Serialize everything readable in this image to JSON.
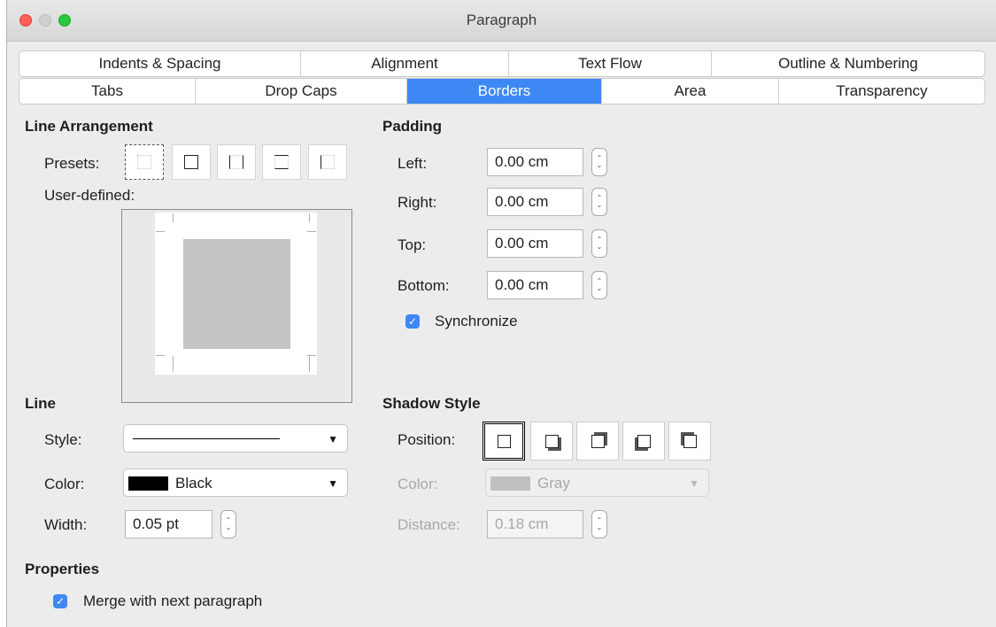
{
  "window": {
    "title": "Paragraph"
  },
  "tabs": {
    "row1": [
      {
        "label": "Indents & Spacing"
      },
      {
        "label": "Alignment"
      },
      {
        "label": "Text Flow"
      },
      {
        "label": "Outline & Numbering"
      }
    ],
    "row2": [
      {
        "label": "Tabs"
      },
      {
        "label": "Drop Caps"
      },
      {
        "label": "Borders",
        "active": true
      },
      {
        "label": "Area"
      },
      {
        "label": "Transparency"
      }
    ]
  },
  "line_arrangement": {
    "title": "Line Arrangement",
    "presets_label": "Presets:",
    "user_defined_label": "User-defined:",
    "presets": [
      "no-borders-icon",
      "all-borders-icon",
      "left-right-borders-icon",
      "top-bottom-borders-icon",
      "left-border-icon"
    ]
  },
  "padding": {
    "title": "Padding",
    "left_label": "Left:",
    "left_value": "0.00 cm",
    "right_label": "Right:",
    "right_value": "0.00 cm",
    "top_label": "Top:",
    "top_value": "0.00 cm",
    "bottom_label": "Bottom:",
    "bottom_value": "0.00 cm",
    "synchronize_label": "Synchronize",
    "synchronize_checked": true
  },
  "line": {
    "title": "Line",
    "style_label": "Style:",
    "color_label": "Color:",
    "color_value": "Black",
    "color_swatch": "#000000",
    "width_label": "Width:",
    "width_value": "0.05 pt"
  },
  "shadow": {
    "title": "Shadow Style",
    "position_label": "Position:",
    "positions": [
      "no-shadow-icon",
      "shadow-bottom-right-icon",
      "shadow-top-right-icon",
      "shadow-bottom-left-icon",
      "shadow-top-left-icon"
    ],
    "color_label": "Color:",
    "color_value": "Gray",
    "color_swatch": "#c0c0c0",
    "distance_label": "Distance:",
    "distance_value": "0.18 cm"
  },
  "properties": {
    "title": "Properties",
    "merge_label": "Merge with next paragraph",
    "merge_checked": true
  },
  "colors": {
    "accent": "#3d88f4"
  }
}
